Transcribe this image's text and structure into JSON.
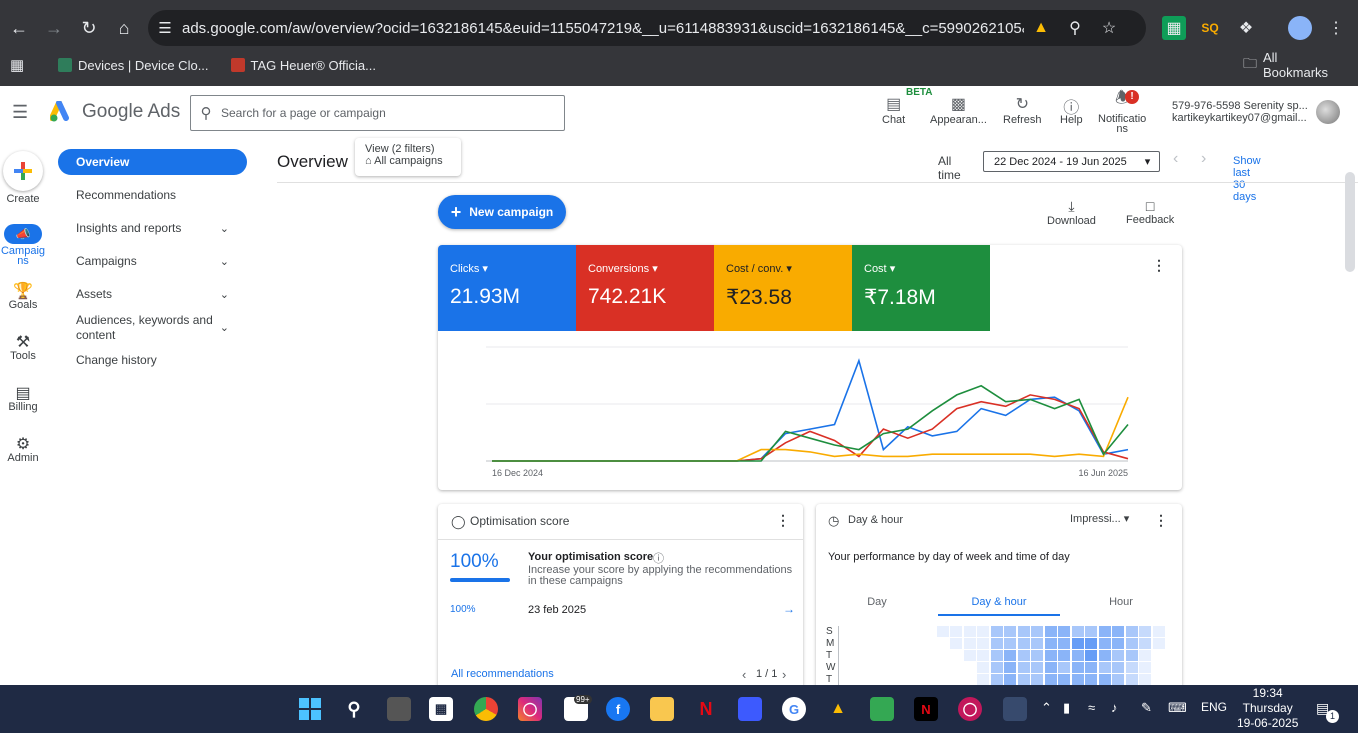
{
  "browser": {
    "url": "ads.google.com/aw/overview?ocid=1632186145&euid=1155047219&__u=6114883931&uscid=1632186145&__c=5990262105&authu...",
    "bookmarks": [
      {
        "label": "Devices | Device Clo...",
        "color": "#2f7d5b"
      },
      {
        "label": "TAG Heuer® Officia...",
        "color": "#c0392b"
      }
    ],
    "all_bookmarks": "All Bookmarks"
  },
  "header": {
    "app_name": "Google Ads",
    "search_placeholder": "Search for a page or campaign",
    "beta": "BETA",
    "buttons": {
      "chat": "Chat",
      "appearance": "Appearan...",
      "refresh": "Refresh",
      "help": "Help",
      "notifications_1": "Notificatio",
      "notifications_2": "ns"
    },
    "notif_count": "!",
    "account_line1": "579-976-5598 Serenity sp...",
    "account_line2": "kartikeykartikey07@gmail..."
  },
  "rail": {
    "create": "Create",
    "campaigns_1": "Campaig",
    "campaigns_2": "ns",
    "goals": "Goals",
    "tools": "Tools",
    "billing": "Billing",
    "admin": "Admin"
  },
  "sidenav": {
    "overview": "Overview",
    "recommendations": "Recommendations",
    "insights": "Insights and reports",
    "campaigns": "Campaigns",
    "assets": "Assets",
    "audiences_1": "Audiences, keywords and",
    "audiences_2": "content",
    "change_history": "Change history"
  },
  "main": {
    "title": "Overview",
    "view_filters": "View (2 filters)",
    "all_campaigns": "All campaigns",
    "all_time": "All time",
    "date_range": "22 Dec 2024 - 19 Jun 2025",
    "show_last": "Show last 30 days",
    "new_campaign": "New campaign",
    "download": "Download",
    "feedback": "Feedback"
  },
  "metrics": [
    {
      "label": "Clicks",
      "value": "21.93M",
      "color": "#1a73e8"
    },
    {
      "label": "Conversions",
      "value": "742.21K",
      "color": "#d93025"
    },
    {
      "label": "Cost / conv.",
      "value": "₹23.58",
      "color": "#f9ab00"
    },
    {
      "label": "Cost",
      "value": "₹7.18M",
      "color": "#1e8e3e"
    }
  ],
  "chart_data": {
    "type": "line",
    "x_start": "16 Dec 2024",
    "x_end": "16 Jun 2025",
    "series": [
      {
        "name": "Clicks",
        "color": "#1a73e8",
        "values": [
          0,
          0,
          0,
          0,
          0,
          0,
          0,
          0,
          0,
          0,
          0,
          1,
          12,
          14,
          16,
          44,
          5,
          15,
          11,
          13,
          23,
          20,
          27,
          28,
          22,
          3,
          5
        ]
      },
      {
        "name": "Conversions",
        "color": "#d93025",
        "values": [
          0,
          0,
          0,
          0,
          0,
          0,
          0,
          0,
          0,
          0,
          0,
          1,
          8,
          13,
          9,
          2,
          14,
          10,
          14,
          23,
          26,
          24,
          29,
          27,
          23,
          4,
          1
        ]
      },
      {
        "name": "Cost / conv.",
        "color": "#f9ab00",
        "values": [
          0,
          0,
          0,
          0,
          0,
          0,
          0,
          0,
          0,
          0,
          0,
          5,
          5,
          4,
          2,
          3,
          2,
          2,
          3,
          3,
          3,
          3,
          3,
          2,
          3,
          2,
          28
        ]
      },
      {
        "name": "Cost",
        "color": "#1e8e3e",
        "values": [
          0,
          0,
          0,
          0,
          0,
          0,
          0,
          0,
          0,
          0,
          0,
          0,
          13,
          10,
          7,
          5,
          12,
          14,
          22,
          29,
          33,
          26,
          27,
          23,
          27,
          3,
          16
        ]
      }
    ],
    "ylim": [
      0,
      50
    ]
  },
  "optimisation": {
    "title": "Optimisation score",
    "score": "100%",
    "your_score": "Your optimisation score",
    "desc1": "Increase your score by applying the recommendations",
    "desc2": "in these campaigns",
    "small_score": "100%",
    "date": "23 feb 2025",
    "all_recs": "All recommendations",
    "pager": "1 / 1"
  },
  "dayhour": {
    "title": "Day & hour",
    "metric_select": "Impressi...",
    "desc": "Your performance by day of week and time of day",
    "tabs": [
      "Day",
      "Day & hour",
      "Hour"
    ],
    "days": [
      "S",
      "M",
      "T",
      "W",
      "T"
    ]
  },
  "taskbar": {
    "time": "19:34",
    "day": "Thursday",
    "date": "19-06-2025",
    "lang": "ENG",
    "notif": "1",
    "badge": "99+"
  }
}
